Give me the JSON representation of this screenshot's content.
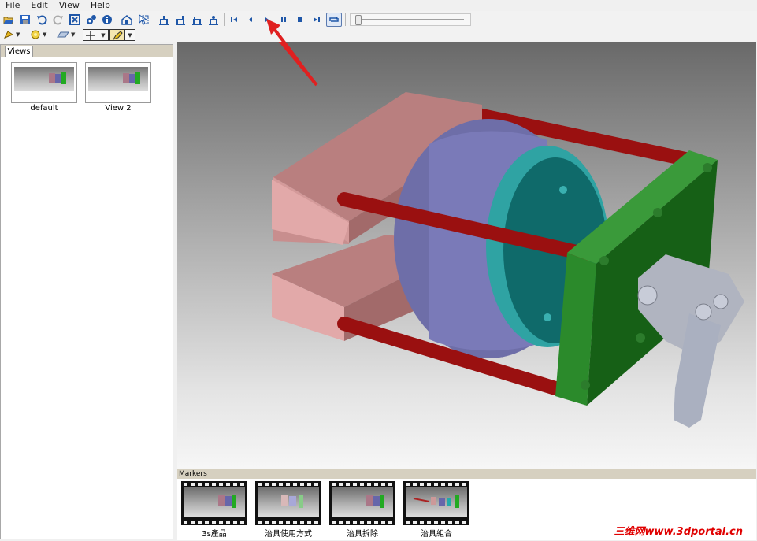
{
  "menubar": {
    "items": [
      "File",
      "Edit",
      "View",
      "Help"
    ]
  },
  "colors": {
    "accent_blue": "#1f57a8",
    "arrow_red": "#e02020",
    "watermark_red": "#e00000",
    "rod_red": "#aa1111",
    "plate_green": "#1f7a1f"
  },
  "toolbar": {
    "icons": [
      "open-icon",
      "save-icon",
      "undo-icon",
      "redo-icon",
      "fit-icon",
      "settings-icon",
      "info-icon",
      "home-view-icon",
      "select-icon",
      "front-view-icon",
      "back-view-icon",
      "top-view-icon",
      "bottom-view-icon",
      "first-frame-icon",
      "previous-frame-icon",
      "play-icon",
      "pause-icon",
      "stop-icon",
      "last-frame-icon",
      "loop-icon"
    ],
    "timeline_position": 0.02
  },
  "left_panel": {
    "tab_label": "Views",
    "views": [
      {
        "label": "default"
      },
      {
        "label": "View 2"
      }
    ]
  },
  "markers": {
    "header": "Markers",
    "items": [
      {
        "label": "3s產品"
      },
      {
        "label": "治具使用方式"
      },
      {
        "label": "治具拆除"
      },
      {
        "label": "治具組合"
      }
    ]
  },
  "watermark": {
    "prefix": "三维网",
    "site": "www.3dportal.cn"
  }
}
